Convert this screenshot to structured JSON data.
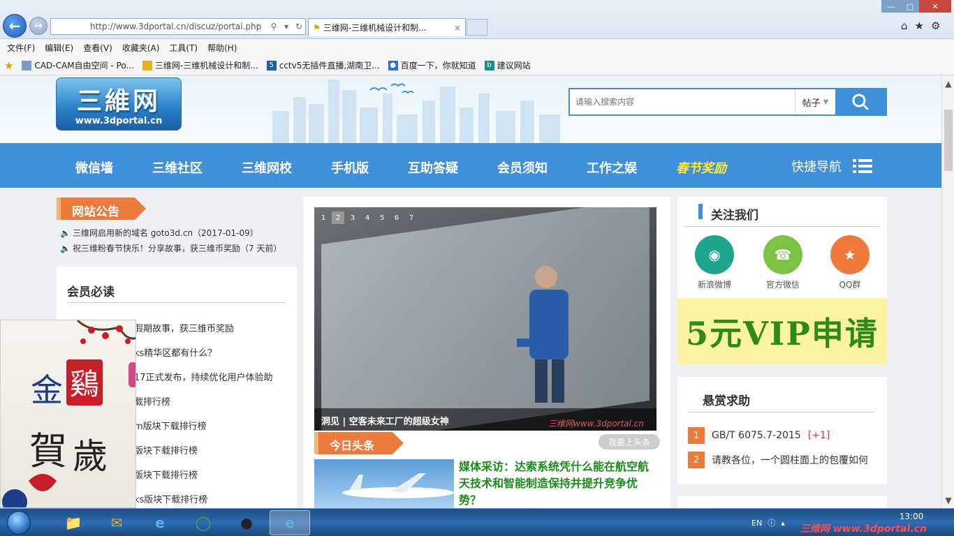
{
  "browser": {
    "url": "http://www.3dportal.cn/discuz/portal.php",
    "tab_title": "三维网-三维机械设计和制...",
    "menu": [
      "文件(F)",
      "编辑(E)",
      "查看(V)",
      "收藏夹(A)",
      "工具(T)",
      "帮助(H)"
    ],
    "favorites": [
      {
        "label": "CAD-CAM自由空间 - Po...",
        "icon": "page-icon"
      },
      {
        "label": "三维网-三维机械设计和制...",
        "icon": "site-icon"
      },
      {
        "label": "cctv5无插件直播,湖南卫...",
        "icon": "five-icon"
      },
      {
        "label": "百度一下，你就知道",
        "icon": "paw-icon"
      },
      {
        "label": "建议网站",
        "icon": "bing-icon"
      }
    ]
  },
  "site": {
    "logo_main": "三維网",
    "logo_sub": "www.3dportal.cn",
    "search_placeholder": "请输入搜索内容",
    "search_type": "帖子",
    "nav": [
      "微信墙",
      "三维社区",
      "三维网校",
      "手机版",
      "互助答疑",
      "会员须知",
      "工作之娱",
      "春节奖励"
    ],
    "quick_nav": "快捷导航",
    "accent_color": "#3f8fd9",
    "orange_color": "#ec7a3c"
  },
  "notice": {
    "title": "网站公告",
    "items": [
      "三维网启用新的域名 goto3d.cn（2017-01-09）",
      "祝三维粉春节快乐！分享故事，获三维币奖励（7 天前）"
    ]
  },
  "must_read": {
    "title": "会员必读",
    "items": [
      "假期故事，获三维币奖励",
      "ks精华区都有什么？",
      "17正式发布，持续优化用户体验助",
      "载排行榜",
      "m版块下载排行榜",
      "版块下载排行榜",
      "版块下载排行榜",
      "ks版块下载排行榜"
    ]
  },
  "popup": {
    "big_chars": [
      "金",
      "鷄",
      "賀",
      "歲"
    ]
  },
  "slider": {
    "pages": [
      "1",
      "2",
      "3",
      "4",
      "5",
      "6",
      "7"
    ],
    "active_page": "2",
    "caption": "洞见 | 空客未来工厂的超级女神",
    "watermark": "三维网www.3dportal.cn"
  },
  "today": {
    "title": "今日头条",
    "want_btn": "我要上头条",
    "headline": "媒体采访：达索系统凭什么能在航空航天技术和智能制造保持并提升竞争优势？"
  },
  "follow": {
    "title": "关注我们",
    "items": [
      {
        "label": "新浪微博",
        "icon": "weibo-icon",
        "color": "#1ea58e"
      },
      {
        "label": "官方微信",
        "icon": "wechat-icon",
        "color": "#7cc244"
      },
      {
        "label": "QQ群",
        "icon": "qq-group-icon",
        "color": "#ef7a3c"
      }
    ],
    "vip": "5元VIP申请"
  },
  "bounty": {
    "title": "悬赏求助",
    "items": [
      {
        "num": "1",
        "text": "GB/T 6075.7-2015",
        "extra": "[+1]"
      },
      {
        "num": "2",
        "text": "请教各位，一个圆柱面上的包覆如何",
        "extra": ""
      }
    ]
  },
  "taskbar": {
    "lang": "EN",
    "time": "13:00",
    "watermark": "三维网 www.3dportal.cn"
  }
}
